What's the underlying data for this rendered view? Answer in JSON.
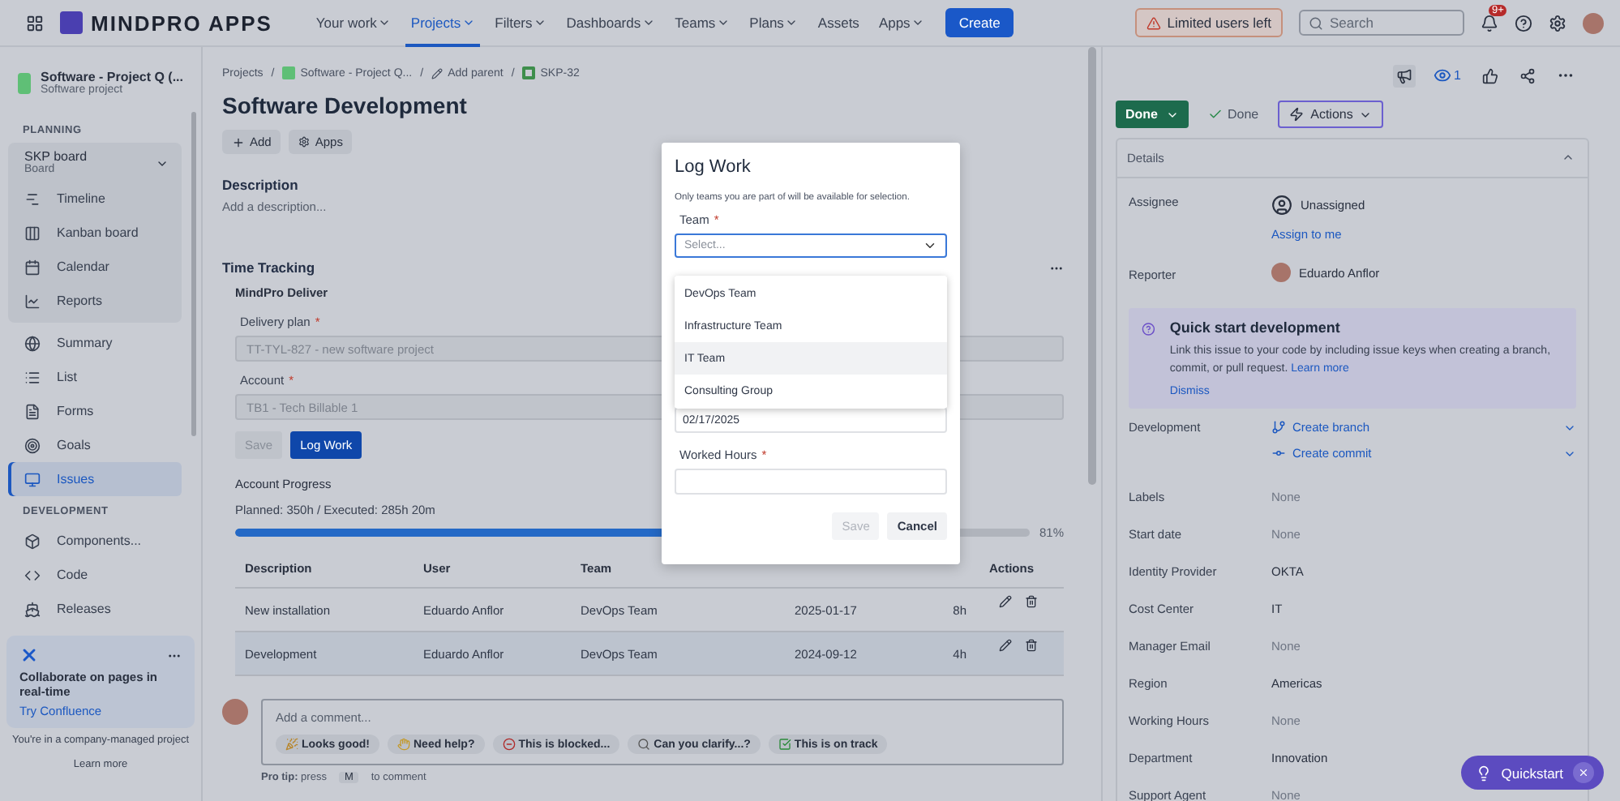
{
  "top_bar": {
    "app_name": "MINDPRO APPS",
    "nav": [
      {
        "label": "Your work",
        "selected": false,
        "menu": true
      },
      {
        "label": "Projects",
        "selected": true,
        "menu": true
      },
      {
        "label": "Filters",
        "selected": false,
        "menu": true
      },
      {
        "label": "Dashboards",
        "selected": false,
        "menu": true
      },
      {
        "label": "Teams",
        "selected": false,
        "menu": true
      },
      {
        "label": "Plans",
        "selected": false,
        "menu": true
      },
      {
        "label": "Assets",
        "selected": false,
        "menu": false
      },
      {
        "label": "Apps",
        "selected": false,
        "menu": true
      }
    ],
    "create_button": "Create",
    "notice": "Limited users left",
    "search": {
      "placeholder": "Search"
    },
    "notification_count": "9+"
  },
  "sidebar": {
    "project": {
      "name": "Software - Project Q (...",
      "type": "Software project"
    },
    "sections": [
      {
        "title": "PLANNING",
        "board": {
          "name": "SKP board",
          "subtitle": "Board",
          "expanded": true,
          "items": [
            {
              "label": "Timeline",
              "selected": false
            },
            {
              "label": "Kanban board",
              "selected": false
            },
            {
              "label": "Calendar",
              "selected": false
            },
            {
              "label": "Reports",
              "selected": false
            }
          ]
        },
        "items": [
          {
            "label": "Summary",
            "selected": false
          },
          {
            "label": "List",
            "selected": false
          },
          {
            "label": "Forms",
            "selected": false
          },
          {
            "label": "Goals",
            "selected": false
          },
          {
            "label": "Issues",
            "selected": true
          }
        ]
      },
      {
        "title": "DEVELOPMENT",
        "items": [
          {
            "label": "Components...",
            "selected": false
          },
          {
            "label": "Code",
            "selected": false
          },
          {
            "label": "Releases",
            "selected": false
          }
        ]
      }
    ],
    "promo": {
      "title": "Collaborate on pages in real-time",
      "link": "Try Confluence"
    },
    "footer": "You're in a company-managed project",
    "learn_more": "Learn more"
  },
  "issue": {
    "breadcrumb": [
      {
        "label": "Projects",
        "kind": "link"
      },
      {
        "label": "Software - Project Q...",
        "kind": "project"
      },
      {
        "label": "Add parent",
        "kind": "parent"
      },
      {
        "label": "SKP-32",
        "kind": "issue"
      }
    ],
    "title": "Software Development",
    "actions": [
      "Add",
      "Apps"
    ],
    "description": {
      "heading": "Description",
      "placeholder": "Add a description..."
    },
    "time_tracking": {
      "heading": "Time Tracking",
      "app": "MindPro Deliver",
      "fields": [
        {
          "label": "Delivery plan",
          "required": true,
          "value": "TT-TYL-827 - new software project",
          "disabled": true
        },
        {
          "label": "Account",
          "required": true,
          "value": "TB1 - Tech Billable 1",
          "disabled": true
        }
      ],
      "save": "Save",
      "log_work": "Log Work",
      "progress": {
        "heading": "Account Progress",
        "summary": "Planned: 350h / Executed: 285h 20m",
        "level": 0.81,
        "reading": "81%"
      },
      "table": {
        "columns": [
          "Description",
          "User",
          "Team",
          "Actions"
        ],
        "rows": [
          {
            "description": "New installation",
            "user": "Eduardo Anflor",
            "team": "DevOps Team",
            "date": "2025-01-17",
            "hours": "8h",
            "highlighted": false
          },
          {
            "description": "Development",
            "user": "Eduardo Anflor",
            "team": "DevOps Team",
            "date": "2024-09-12",
            "hours": "4h",
            "highlighted": true
          }
        ]
      }
    },
    "comment": {
      "placeholder": "Add a comment...",
      "chips": [
        "Looks good!",
        "Need help?",
        "This is blocked...",
        "Can you clarify...?",
        "This is on track"
      ],
      "tip": "**Pro tip:** press",
      "key": "M",
      "tip_end": "to comment"
    }
  },
  "modal": {
    "title": "Log Work",
    "note": "Only teams you are part of will be available for selection.",
    "team": {
      "label": "Team",
      "required": true,
      "placeholder": "Select...",
      "options": [
        {
          "label": "DevOps Team",
          "highlighted": false
        },
        {
          "label": "Infrastructure Team",
          "highlighted": false
        },
        {
          "label": "IT Team",
          "highlighted": true
        },
        {
          "label": "Consulting Group",
          "highlighted": false
        }
      ]
    },
    "date": "02/17/2025",
    "hours": {
      "label": "Worked Hours",
      "required": true
    },
    "save": "Save",
    "cancel": "Cancel"
  },
  "details_panel": {
    "watchers": "1",
    "status": "Done",
    "resolution": "Done",
    "actions": "Actions",
    "details": {
      "heading": "Details",
      "expanded": true,
      "fields": [
        {
          "kind": "assignee",
          "label": "Assignee",
          "value": "Unassigned",
          "link": "Assign to me"
        },
        {
          "kind": "person",
          "label": "Reporter",
          "value": "Eduardo Anflor"
        },
        {
          "kind": "tip",
          "title": "Quick start development",
          "text": "Link this issue to your code by including issue keys when creating a branch, commit, or pull request.",
          "link": "Learn more",
          "dismiss": "Dismiss"
        },
        {
          "kind": "dev",
          "label": "Development",
          "links": [
            "Create branch",
            "Create commit"
          ]
        },
        {
          "kind": "text",
          "label": "Labels",
          "value": "None",
          "empty": true
        },
        {
          "kind": "text",
          "label": "Start date",
          "value": "None",
          "empty": true
        },
        {
          "kind": "text",
          "label": "Identity Provider",
          "value": "OKTA",
          "empty": false
        },
        {
          "kind": "text",
          "label": "Cost Center",
          "value": "IT",
          "empty": false
        },
        {
          "kind": "text",
          "label": "Manager Email",
          "value": "None",
          "empty": true
        },
        {
          "kind": "text",
          "label": "Region",
          "value": "Americas",
          "empty": false
        },
        {
          "kind": "text",
          "label": "Working Hours",
          "value": "None",
          "empty": true
        },
        {
          "kind": "text",
          "label": "Department",
          "value": "Innovation",
          "empty": false
        },
        {
          "kind": "text",
          "label": "Support Agent",
          "value": "None",
          "empty": true
        }
      ]
    }
  },
  "quickstart": "Quickstart",
  "required_mark": "*",
  "breadcrumb_separator": "/"
}
